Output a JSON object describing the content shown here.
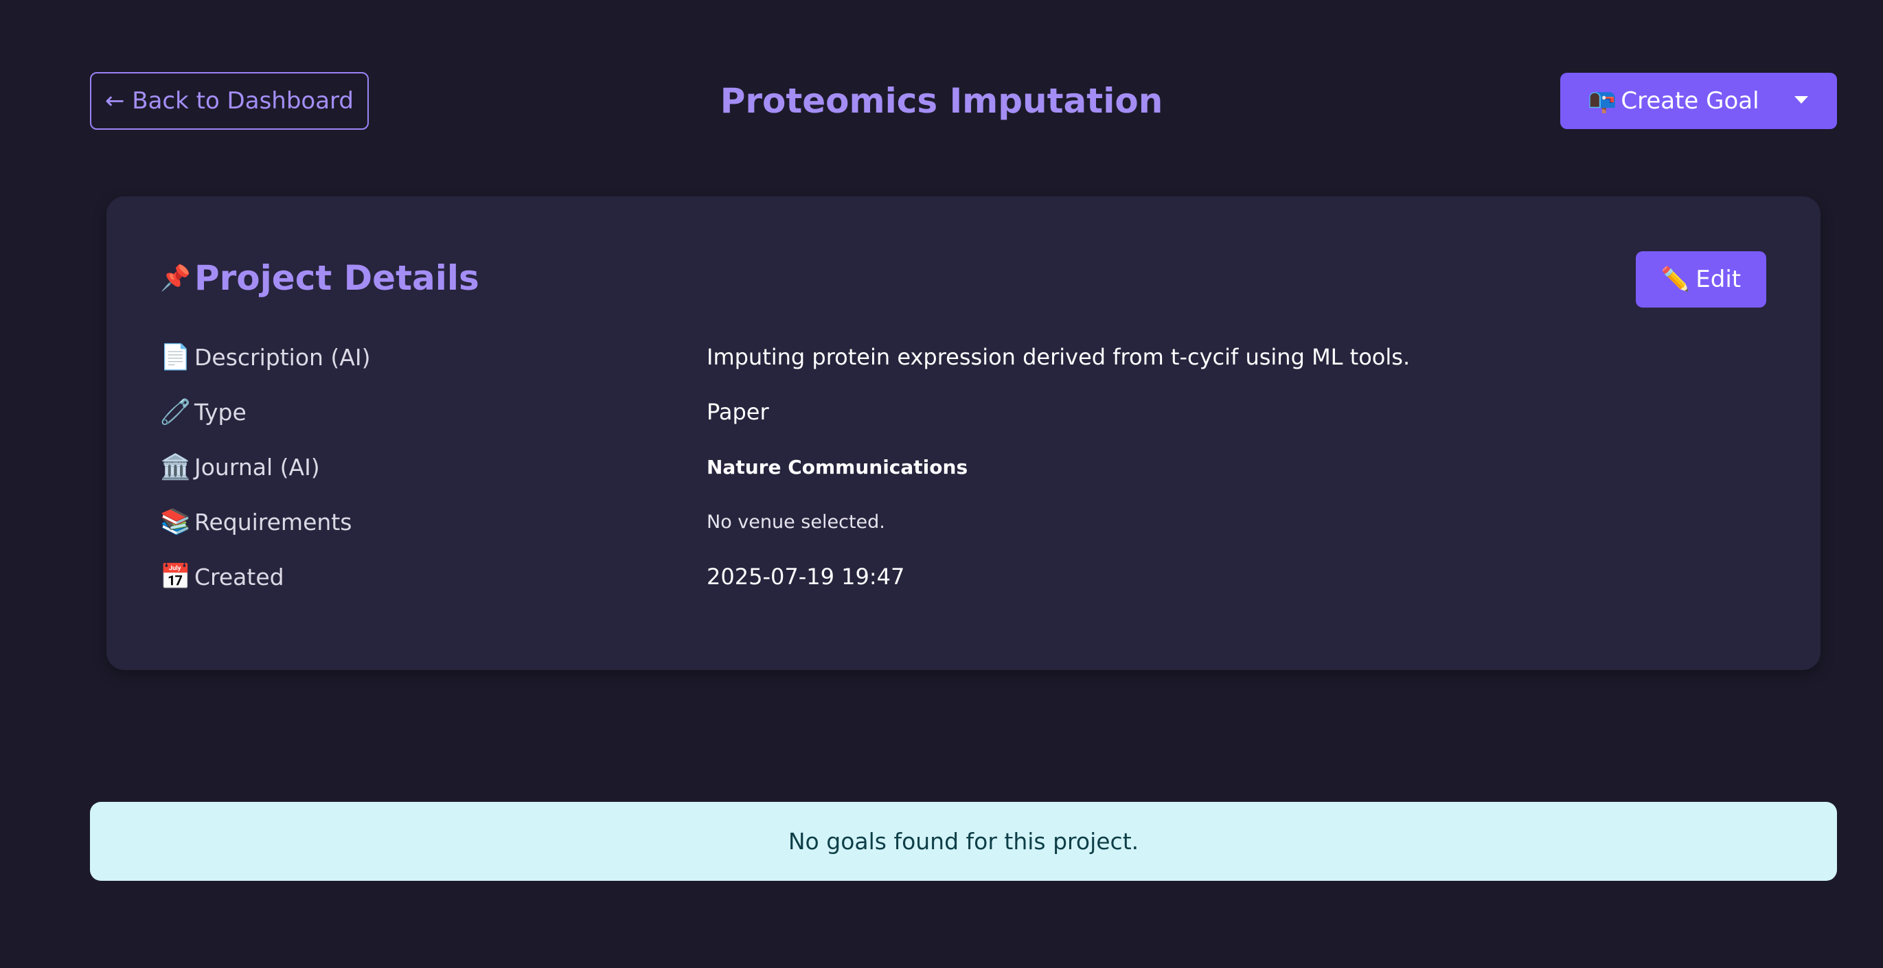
{
  "header": {
    "back_label": "← Back to Dashboard",
    "title": "Proteomics Imputation",
    "create_goal": {
      "icon": "📭",
      "label": "Create Goal"
    }
  },
  "project_details": {
    "icon": "📌",
    "title": "Project Details",
    "edit": {
      "icon": "✏️",
      "label": "Edit"
    },
    "rows": [
      {
        "icon": "📄",
        "label": "Description (AI)",
        "value": "Imputing protein expression derived from t-cycif using ML tools."
      },
      {
        "icon": "🧷",
        "label": "Type",
        "value": "Paper"
      },
      {
        "icon": "🏛️",
        "label": "Journal (AI)",
        "value": "Nature Communications"
      },
      {
        "icon": "📚",
        "label": "Requirements",
        "value": "No venue selected."
      },
      {
        "icon": "📅",
        "label": "Created",
        "value": "2025-07-19 19:47"
      }
    ]
  },
  "goals_alert": "No goals found for this project.",
  "colors": {
    "background": "#1c1a2a",
    "card": "#27243d",
    "accent": "#7b5cf9",
    "title": "#a48ef5",
    "alert_bg": "#d3f4f8",
    "alert_text": "#0d3e48"
  }
}
